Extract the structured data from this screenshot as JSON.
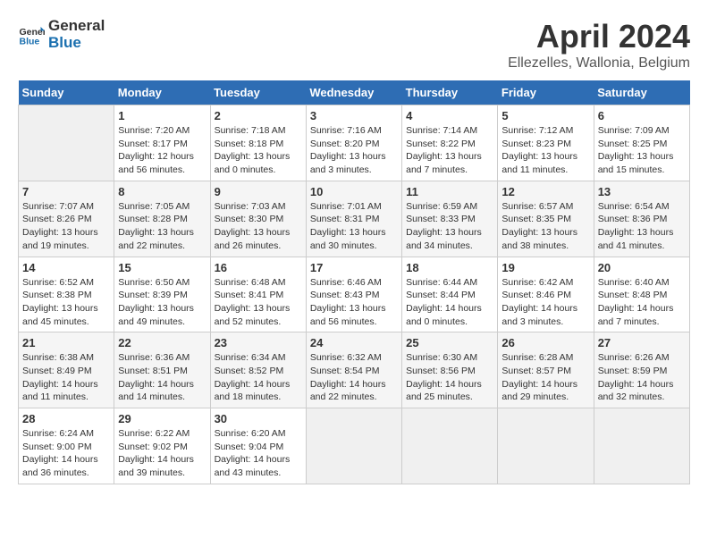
{
  "header": {
    "logo_general": "General",
    "logo_blue": "Blue",
    "month_year": "April 2024",
    "location": "Ellezelles, Wallonia, Belgium"
  },
  "days_of_week": [
    "Sunday",
    "Monday",
    "Tuesday",
    "Wednesday",
    "Thursday",
    "Friday",
    "Saturday"
  ],
  "weeks": [
    [
      {
        "day": "",
        "info": ""
      },
      {
        "day": "1",
        "info": "Sunrise: 7:20 AM\nSunset: 8:17 PM\nDaylight: 12 hours\nand 56 minutes."
      },
      {
        "day": "2",
        "info": "Sunrise: 7:18 AM\nSunset: 8:18 PM\nDaylight: 13 hours\nand 0 minutes."
      },
      {
        "day": "3",
        "info": "Sunrise: 7:16 AM\nSunset: 8:20 PM\nDaylight: 13 hours\nand 3 minutes."
      },
      {
        "day": "4",
        "info": "Sunrise: 7:14 AM\nSunset: 8:22 PM\nDaylight: 13 hours\nand 7 minutes."
      },
      {
        "day": "5",
        "info": "Sunrise: 7:12 AM\nSunset: 8:23 PM\nDaylight: 13 hours\nand 11 minutes."
      },
      {
        "day": "6",
        "info": "Sunrise: 7:09 AM\nSunset: 8:25 PM\nDaylight: 13 hours\nand 15 minutes."
      }
    ],
    [
      {
        "day": "7",
        "info": "Sunrise: 7:07 AM\nSunset: 8:26 PM\nDaylight: 13 hours\nand 19 minutes."
      },
      {
        "day": "8",
        "info": "Sunrise: 7:05 AM\nSunset: 8:28 PM\nDaylight: 13 hours\nand 22 minutes."
      },
      {
        "day": "9",
        "info": "Sunrise: 7:03 AM\nSunset: 8:30 PM\nDaylight: 13 hours\nand 26 minutes."
      },
      {
        "day": "10",
        "info": "Sunrise: 7:01 AM\nSunset: 8:31 PM\nDaylight: 13 hours\nand 30 minutes."
      },
      {
        "day": "11",
        "info": "Sunrise: 6:59 AM\nSunset: 8:33 PM\nDaylight: 13 hours\nand 34 minutes."
      },
      {
        "day": "12",
        "info": "Sunrise: 6:57 AM\nSunset: 8:35 PM\nDaylight: 13 hours\nand 38 minutes."
      },
      {
        "day": "13",
        "info": "Sunrise: 6:54 AM\nSunset: 8:36 PM\nDaylight: 13 hours\nand 41 minutes."
      }
    ],
    [
      {
        "day": "14",
        "info": "Sunrise: 6:52 AM\nSunset: 8:38 PM\nDaylight: 13 hours\nand 45 minutes."
      },
      {
        "day": "15",
        "info": "Sunrise: 6:50 AM\nSunset: 8:39 PM\nDaylight: 13 hours\nand 49 minutes."
      },
      {
        "day": "16",
        "info": "Sunrise: 6:48 AM\nSunset: 8:41 PM\nDaylight: 13 hours\nand 52 minutes."
      },
      {
        "day": "17",
        "info": "Sunrise: 6:46 AM\nSunset: 8:43 PM\nDaylight: 13 hours\nand 56 minutes."
      },
      {
        "day": "18",
        "info": "Sunrise: 6:44 AM\nSunset: 8:44 PM\nDaylight: 14 hours\nand 0 minutes."
      },
      {
        "day": "19",
        "info": "Sunrise: 6:42 AM\nSunset: 8:46 PM\nDaylight: 14 hours\nand 3 minutes."
      },
      {
        "day": "20",
        "info": "Sunrise: 6:40 AM\nSunset: 8:48 PM\nDaylight: 14 hours\nand 7 minutes."
      }
    ],
    [
      {
        "day": "21",
        "info": "Sunrise: 6:38 AM\nSunset: 8:49 PM\nDaylight: 14 hours\nand 11 minutes."
      },
      {
        "day": "22",
        "info": "Sunrise: 6:36 AM\nSunset: 8:51 PM\nDaylight: 14 hours\nand 14 minutes."
      },
      {
        "day": "23",
        "info": "Sunrise: 6:34 AM\nSunset: 8:52 PM\nDaylight: 14 hours\nand 18 minutes."
      },
      {
        "day": "24",
        "info": "Sunrise: 6:32 AM\nSunset: 8:54 PM\nDaylight: 14 hours\nand 22 minutes."
      },
      {
        "day": "25",
        "info": "Sunrise: 6:30 AM\nSunset: 8:56 PM\nDaylight: 14 hours\nand 25 minutes."
      },
      {
        "day": "26",
        "info": "Sunrise: 6:28 AM\nSunset: 8:57 PM\nDaylight: 14 hours\nand 29 minutes."
      },
      {
        "day": "27",
        "info": "Sunrise: 6:26 AM\nSunset: 8:59 PM\nDaylight: 14 hours\nand 32 minutes."
      }
    ],
    [
      {
        "day": "28",
        "info": "Sunrise: 6:24 AM\nSunset: 9:00 PM\nDaylight: 14 hours\nand 36 minutes."
      },
      {
        "day": "29",
        "info": "Sunrise: 6:22 AM\nSunset: 9:02 PM\nDaylight: 14 hours\nand 39 minutes."
      },
      {
        "day": "30",
        "info": "Sunrise: 6:20 AM\nSunset: 9:04 PM\nDaylight: 14 hours\nand 43 minutes."
      },
      {
        "day": "",
        "info": ""
      },
      {
        "day": "",
        "info": ""
      },
      {
        "day": "",
        "info": ""
      },
      {
        "day": "",
        "info": ""
      }
    ]
  ]
}
